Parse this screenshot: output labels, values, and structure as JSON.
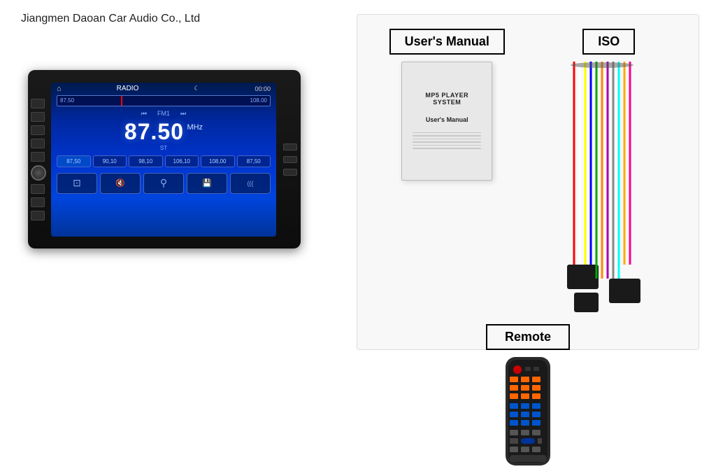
{
  "company": {
    "name": "Jiangmen Daoan Car Audio Co., Ltd"
  },
  "radio": {
    "mode": "RADIO",
    "time": "00:00",
    "freq_low": "87.50",
    "freq_high": "108.00",
    "fm_label": "FM1",
    "frequency": "87.50",
    "unit": "MHz",
    "stereo": "ST",
    "presets": [
      "87,50",
      "90,10",
      "98,10",
      "106,10",
      "108,00",
      "87,50"
    ]
  },
  "right_panel": {
    "manual_label": "User's Manual",
    "manual_book_title": "MP5 PLAYER SYSTEM",
    "manual_book_subtitle": "User's Manual",
    "iso_label": "ISO",
    "remote_label": "Remote"
  }
}
